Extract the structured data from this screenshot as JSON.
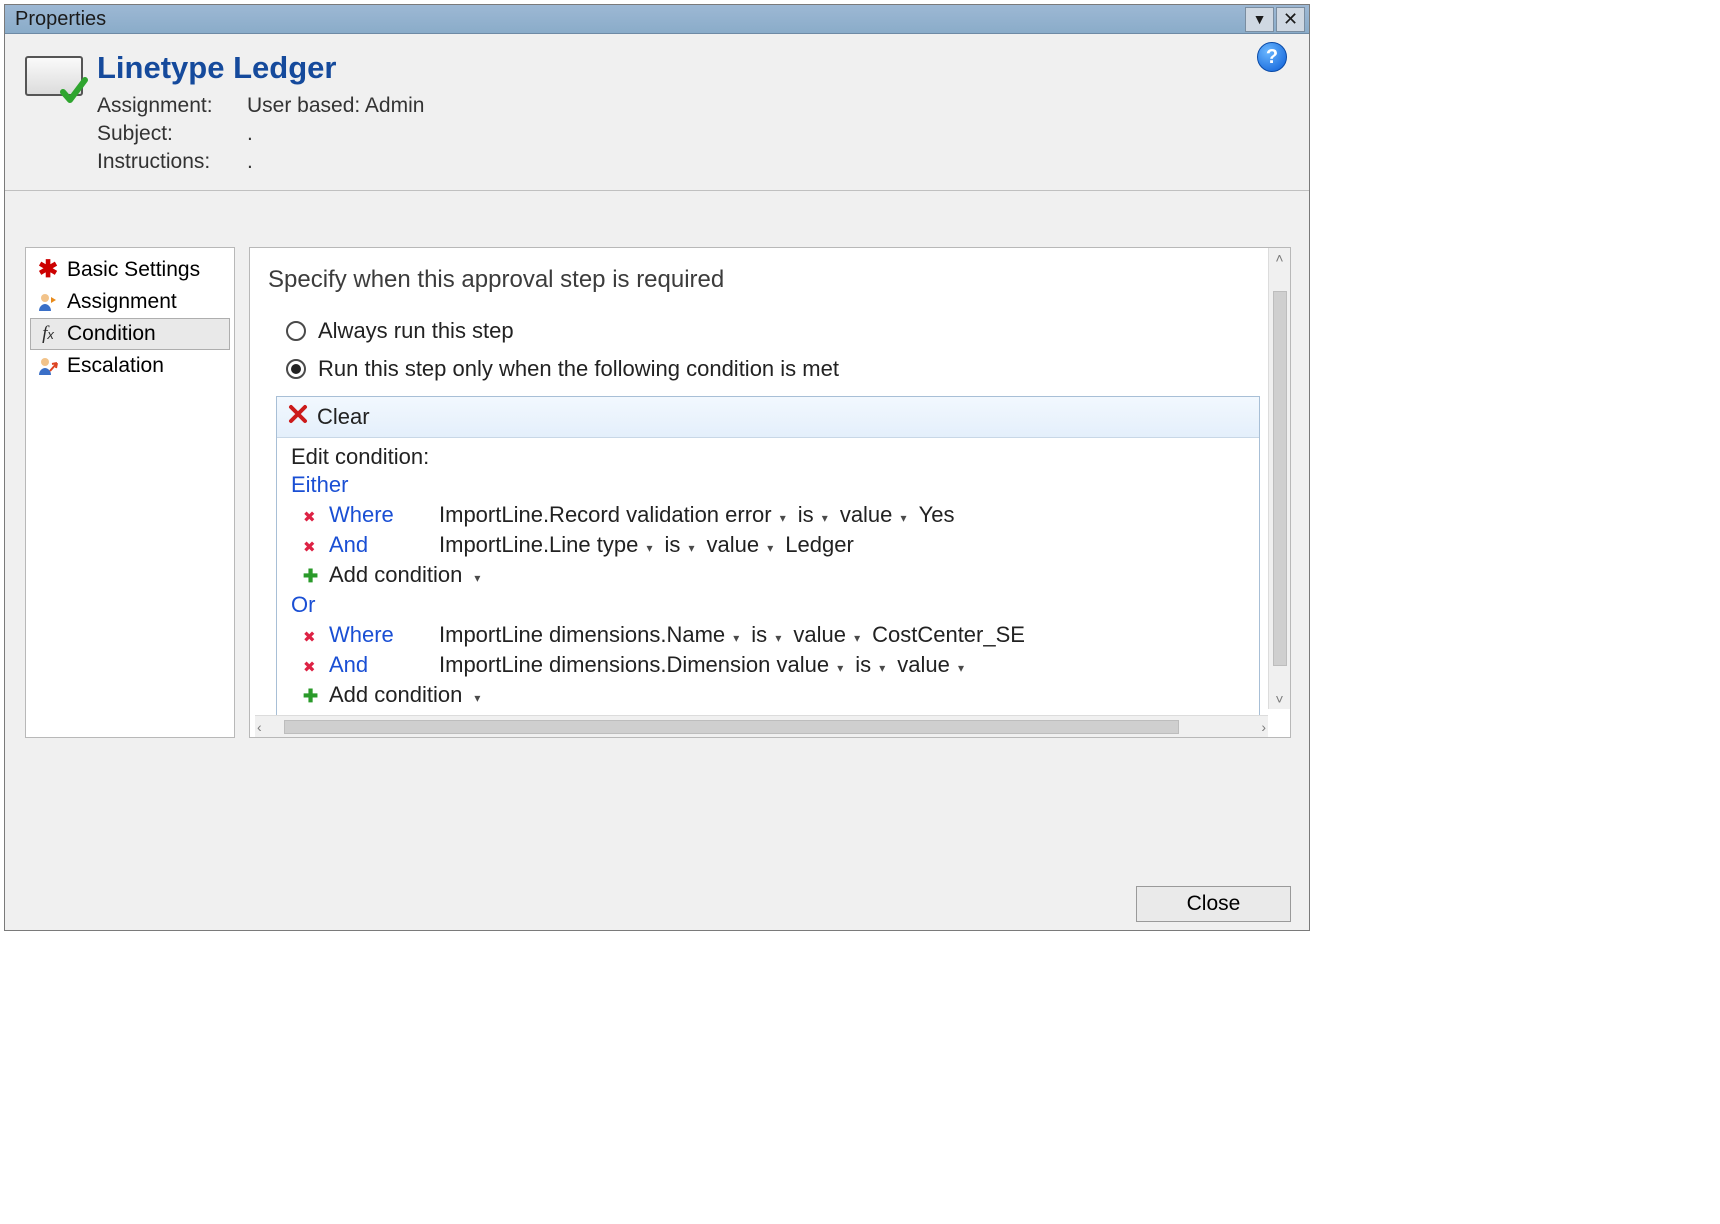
{
  "titlebar": {
    "title": "Properties"
  },
  "header": {
    "title": "Linetype Ledger",
    "labels": {
      "assignment": "Assignment:",
      "subject": "Subject:",
      "instructions": "Instructions:"
    },
    "values": {
      "assignment": "User based: Admin",
      "subject": ".",
      "instructions": "."
    }
  },
  "nav": {
    "items": [
      {
        "id": "basic",
        "label": "Basic Settings"
      },
      {
        "id": "assignment",
        "label": "Assignment"
      },
      {
        "id": "condition",
        "label": "Condition"
      },
      {
        "id": "escalation",
        "label": "Escalation"
      }
    ],
    "selected": "condition"
  },
  "main": {
    "heading": "Specify when this approval step is required",
    "options": {
      "always": "Always run this step",
      "conditional": "Run this step only when the following condition is met",
      "selected": "conditional"
    },
    "toolbar": {
      "clear": "Clear"
    },
    "editLabel": "Edit condition:",
    "groupEither": "Either",
    "groupOr": "Or",
    "addCondition": "Add condition",
    "kw": {
      "where": "Where",
      "and": "And",
      "is": "is",
      "value": "value"
    },
    "lines": {
      "g1l1": {
        "field": "ImportLine.Record validation error",
        "val": "Yes"
      },
      "g1l2": {
        "field": "ImportLine.Line type",
        "val": "Ledger"
      },
      "g2l1": {
        "field": "ImportLine dimensions.Name",
        "val": "CostCenter_SE"
      },
      "g2l2": {
        "field": "ImportLine dimensions.Dimension value",
        "val": ""
      }
    }
  },
  "footer": {
    "close": "Close"
  }
}
